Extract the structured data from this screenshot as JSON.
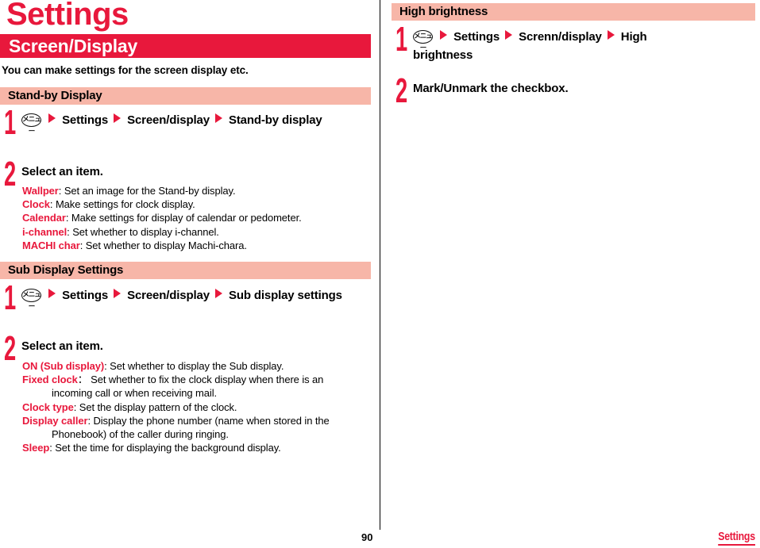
{
  "meta": {
    "chapter_title": "Settings",
    "accent_red": "#E8183C",
    "band_pink": "#F7B6A8",
    "menu_key_glyph": "メニュー",
    "arrow_glyph": "triangle-right-icon",
    "page_number": "90",
    "footer_chapter": "Settings"
  },
  "section": {
    "title": "Screen/Display",
    "intro": "You can make settings for the screen display etc."
  },
  "left_column": {
    "blocks": [
      {
        "heading": "Stand-by Display",
        "steps": [
          {
            "number": "1",
            "parts": [
              "menu-key",
              "Settings",
              "Screen/display",
              "Stand-by display"
            ]
          },
          {
            "number": "2",
            "text": "Select an item.",
            "options": [
              {
                "name": "Wallper",
                "sep": ": ",
                "desc": "Set an image for the Stand-by display."
              },
              {
                "name": "Clock",
                "sep": ": ",
                "desc": "Make settings for clock display."
              },
              {
                "name": "Calendar",
                "sep": ": ",
                "desc": "Make settings for display of calendar or pedometer."
              },
              {
                "name": "i-channel",
                "sep": ": ",
                "desc": "Set whether to display i-channel."
              },
              {
                "name": "MACHI char",
                "sep": ": ",
                "desc": "Set whether to display Machi-chara."
              }
            ]
          }
        ]
      },
      {
        "heading": "Sub Display Settings",
        "steps": [
          {
            "number": "1",
            "parts": [
              "menu-key",
              "Settings",
              "Screen/display",
              "Sub display settings"
            ]
          },
          {
            "number": "2",
            "text": "Select an item.",
            "options": [
              {
                "name": "ON (Sub display)",
                "sep": ": ",
                "desc": "Set whether to display the Sub display."
              },
              {
                "name": "Fixed clock",
                "sep": "： ",
                "desc": "Set whether to fix the clock display when there is an",
                "cont": "incoming call or when receiving mail."
              },
              {
                "name": "Clock type",
                "sep": ": ",
                "desc": "Set the display pattern of the clock."
              },
              {
                "name": "Display caller",
                "sep": ": ",
                "desc": "Display the phone number (name when stored in the",
                "cont": "Phonebook) of the caller during ringing."
              },
              {
                "name": "Sleep",
                "sep": ": ",
                "desc": "Set the time for displaying the background display."
              }
            ]
          }
        ]
      }
    ]
  },
  "right_column": {
    "blocks": [
      {
        "heading": "High brightness",
        "steps": [
          {
            "number": "1",
            "parts": [
              "menu-key",
              "Settings",
              "Screnn/display",
              "High brightness"
            ]
          },
          {
            "number": "2",
            "text": "Mark/Unmark the checkbox."
          }
        ]
      }
    ]
  }
}
